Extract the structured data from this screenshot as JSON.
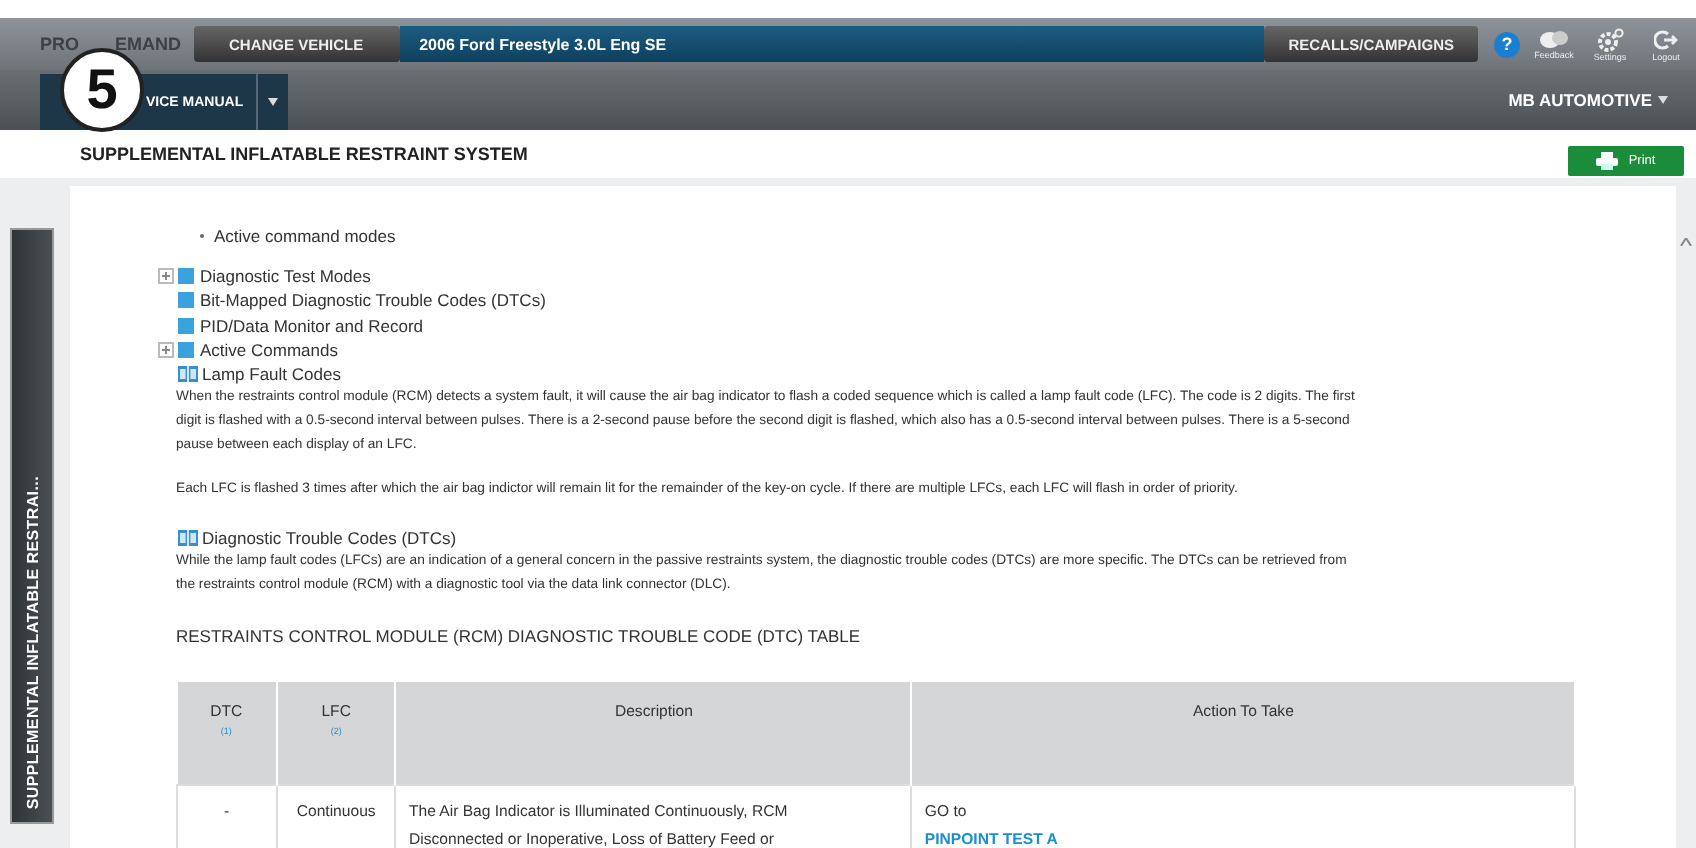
{
  "header": {
    "logo_parts": [
      "PRO",
      "EMAND"
    ],
    "change_vehicle": "CHANGE VEHICLE",
    "vehicle": "2006 Ford Freestyle 3.0L Eng SE",
    "recalls": "RECALLS/CAMPAIGNS",
    "help": "?",
    "tools": [
      {
        "kind": "feedback",
        "label": "Feedback"
      },
      {
        "kind": "settings",
        "label": "Settings"
      },
      {
        "kind": "logout",
        "label": "Logout"
      }
    ]
  },
  "callout": "5",
  "nav": {
    "tab": "VICE MANUAL",
    "account": "MB AUTOMOTIVE"
  },
  "page_title": "SUPPLEMENTAL INFLATABLE RESTRAINT SYSTEM",
  "print": "Print",
  "side_tab": "SUPPLEMENTAL INFLATABLE RESTRAI...",
  "content": {
    "bullet": "Active command modes",
    "topics": [
      {
        "label": "Diagnostic Test Modes",
        "expanded": false
      },
      {
        "label": "Bit-Mapped Diagnostic Trouble Codes (DTCs)"
      },
      {
        "label": "PID/Data Monitor and Record"
      },
      {
        "label": "Active Commands",
        "expanded": false
      }
    ],
    "sections": [
      {
        "title": "Lamp Fault Codes",
        "paragraphs": [
          [
            "When the restraints control module (RCM) detects a system fault, it will cause the air bag indicator to flash a coded sequence which is called a lamp fault code (LFC). The code is 2 digits. The first",
            "digit is flashed with a 0.5-second interval between pulses. There is a 2-second pause before the second digit is flashed, which also has a 0.5-second interval between pulses. There is a 5-second",
            "pause between each display of an LFC."
          ],
          [
            "Each LFC is flashed 3 times after which the air bag indictor will remain lit for the remainder of the key-on cycle. If there are multiple LFCs, each LFC will flash in order of priority."
          ]
        ]
      },
      {
        "title": "Diagnostic Trouble Codes (DTCs)",
        "paragraphs": [
          [
            "While the lamp fault codes (LFCs) are an indication of a general concern in the passive restraints system, the diagnostic trouble codes (DTCs) are more specific. The DTCs can be retrieved from",
            "the restraints control module (RCM) with a diagnostic tool via the data link connector (DLC)."
          ]
        ]
      }
    ],
    "table_title": "RESTRAINTS CONTROL MODULE (RCM) DIAGNOSTIC TROUBLE CODE (DTC) TABLE",
    "table": {
      "columns": [
        {
          "label": "DTC",
          "note": "(1)"
        },
        {
          "label": "LFC",
          "note": "(2)"
        },
        {
          "label": "Description"
        },
        {
          "label": "Action To Take"
        }
      ],
      "rows": [
        {
          "dtc": "-",
          "lfc": "Continuous",
          "description": [
            "The Air Bag Indicator is Illuminated Continuously, RCM",
            "Disconnected or Inoperative, Loss of Battery Feed or"
          ],
          "action": "GO to",
          "link": "PINPOINT TEST A"
        }
      ]
    }
  }
}
